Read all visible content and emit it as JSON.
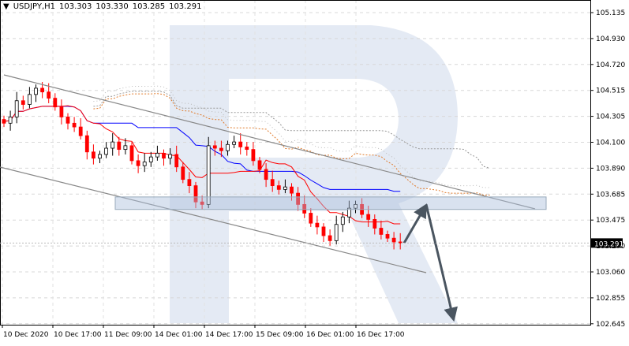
{
  "header": {
    "symbol": "USDJPY,H1",
    "open": "103.303",
    "high": "103.330",
    "low": "103.285",
    "close": "103.291"
  },
  "chart_data": {
    "type": "candlestick",
    "title": "USDJPY,H1",
    "ylim": [
      102.645,
      105.135
    ],
    "y_ticks": [
      "105.135",
      "104.930",
      "104.720",
      "104.515",
      "104.305",
      "104.100",
      "103.890",
      "103.685",
      "103.475",
      "103.270",
      "103.060",
      "102.855",
      "102.645"
    ],
    "x_ticks": [
      "10 Dec 2020",
      "10 Dec 17:00",
      "11 Dec 09:00",
      "14 Dec 01:00",
      "14 Dec 17:00",
      "15 Dec 09:00",
      "16 Dec 01:00",
      "16 Dec 17:00"
    ],
    "current_price": "103.291",
    "closes": [
      104.25,
      104.3,
      104.43,
      104.4,
      104.48,
      104.53,
      104.5,
      104.45,
      104.38,
      104.3,
      104.25,
      104.22,
      104.15,
      104.02,
      103.97,
      104.0,
      104.05,
      104.1,
      104.04,
      104.07,
      103.95,
      103.91,
      103.94,
      103.98,
      104.01,
      103.97,
      104.0,
      103.9,
      103.8,
      103.75,
      103.62,
      103.6,
      104.07,
      104.05,
      104.03,
      104.08,
      104.1,
      104.06,
      104.04,
      103.95,
      103.88,
      103.8,
      103.75,
      103.72,
      103.74,
      103.69,
      103.6,
      103.53,
      103.45,
      103.42,
      103.35,
      103.31,
      103.44,
      103.5,
      103.57,
      103.6,
      103.52,
      103.48,
      103.41,
      103.36,
      103.33,
      103.3,
      103.29
    ],
    "indicators": [
      "Ichimoku Tenkan-sen",
      "Ichimoku Kijun-sen",
      "Ichimoku Cloud"
    ],
    "annotations": {
      "channel": "descending channel",
      "zone": [
        103.56,
        103.66
      ],
      "forecast_path": [
        103.291,
        103.6,
        102.66
      ]
    },
    "colors": {
      "bull": "#000000",
      "bear": "#ff0000",
      "tenkan": "#ff0000",
      "kijun": "#0000ff",
      "cloud": "#e07a2a",
      "watermark": "#dfe6f2"
    }
  }
}
